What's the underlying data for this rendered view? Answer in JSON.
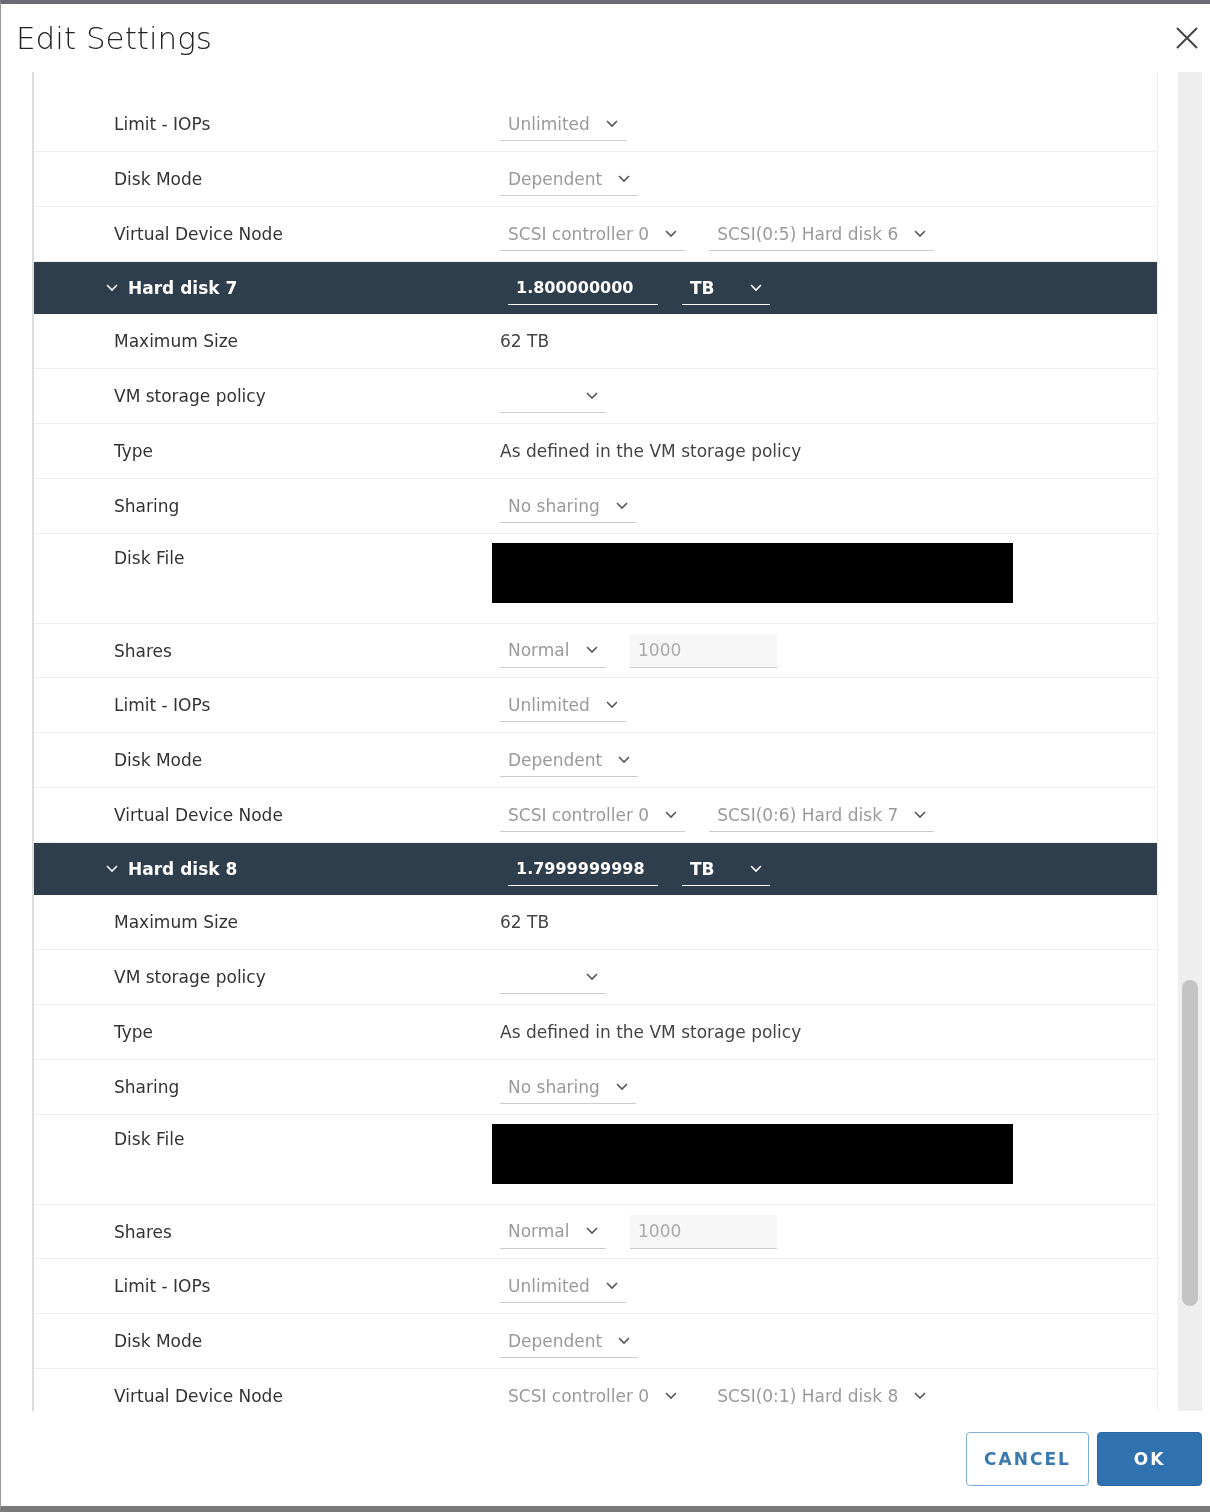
{
  "window": {
    "title": "Edit Settings"
  },
  "rows": [
    {
      "kind": "select",
      "label": "Limit - IOPs",
      "value": "Unlimited"
    },
    {
      "kind": "select",
      "label": "Disk Mode",
      "value": "Dependent"
    },
    {
      "kind": "two_selects",
      "label": "Virtual Device Node",
      "value": "SCSI controller 0",
      "value2": "SCSI(0:5) Hard disk 6"
    },
    {
      "kind": "disk_header",
      "label": "Hard disk 7",
      "value": "1.800000000",
      "unit": "TB",
      "expanded": true
    },
    {
      "kind": "text",
      "label": "Maximum Size",
      "value": "62 TB"
    },
    {
      "kind": "select",
      "label": "VM storage policy"
    },
    {
      "kind": "text",
      "label": "Type",
      "value": "As defined in the VM storage policy"
    },
    {
      "kind": "select",
      "label": "Sharing",
      "value": "No sharing"
    },
    {
      "kind": "redacted",
      "label": "Disk File"
    },
    {
      "kind": "select_input",
      "label": "Shares",
      "value": "Normal",
      "value2": "1000"
    },
    {
      "kind": "select",
      "label": "Limit - IOPs",
      "value": "Unlimited"
    },
    {
      "kind": "select",
      "label": "Disk Mode",
      "value": "Dependent"
    },
    {
      "kind": "two_selects",
      "label": "Virtual Device Node",
      "value": "SCSI controller 0",
      "value2": "SCSI(0:6) Hard disk 7"
    },
    {
      "kind": "disk_header",
      "label": "Hard disk 8",
      "value": "1.7999999998",
      "unit": "TB",
      "expanded": true
    },
    {
      "kind": "text",
      "label": "Maximum Size",
      "value": "62 TB"
    },
    {
      "kind": "select",
      "label": "VM storage policy"
    },
    {
      "kind": "text",
      "label": "Type",
      "value": "As defined in the VM storage policy"
    },
    {
      "kind": "select",
      "label": "Sharing",
      "value": "No sharing"
    },
    {
      "kind": "redacted",
      "label": "Disk File"
    },
    {
      "kind": "select_input",
      "label": "Shares",
      "value": "Normal",
      "value2": "1000"
    },
    {
      "kind": "select",
      "label": "Limit - IOPs",
      "value": "Unlimited"
    },
    {
      "kind": "select",
      "label": "Disk Mode",
      "value": "Dependent"
    },
    {
      "kind": "two_selects",
      "label": "Virtual Device Node",
      "value": "SCSI controller 0",
      "value2": "SCSI(0:1) Hard disk 8"
    }
  ],
  "buttons": [
    {
      "label": "CANCEL",
      "kind": "secondary"
    },
    {
      "label": "OK",
      "kind": "primary"
    }
  ]
}
